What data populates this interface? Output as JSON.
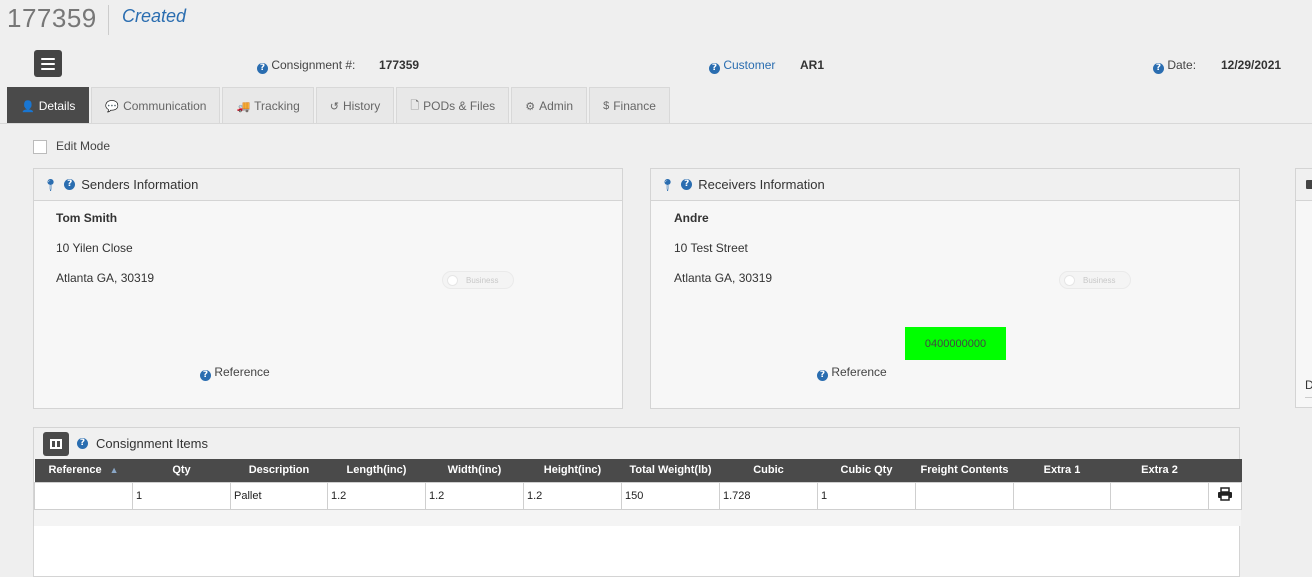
{
  "header": {
    "consignment_number": "177359",
    "status": "Created",
    "consignment_label": "Consignment #:",
    "consignment_value": "177359",
    "customer_label": "Customer",
    "customer_value": "AR1",
    "date_label": "Date:",
    "date_value": "12/29/2021"
  },
  "tabs": [
    {
      "label": "Details",
      "icon": "user-icon",
      "glyph": "👤"
    },
    {
      "label": "Communication",
      "icon": "comment-icon",
      "glyph": "💬"
    },
    {
      "label": "Tracking",
      "icon": "truck-icon",
      "glyph": "🚚"
    },
    {
      "label": "History",
      "icon": "history-icon",
      "glyph": "↺"
    },
    {
      "label": "PODs & Files",
      "icon": "file-icon",
      "glyph": "🗋"
    },
    {
      "label": "Admin",
      "icon": "gear-icon",
      "glyph": "⚙"
    },
    {
      "label": "Finance",
      "icon": "dollar-icon",
      "glyph": "$"
    }
  ],
  "edit_mode": {
    "label": "Edit Mode",
    "checked": false
  },
  "senders": {
    "title": "Senders Information",
    "name": "Tom Smith",
    "address1": "10 Yilen Close",
    "address2": "Atlanta GA, 30319",
    "business_label": "Business",
    "reference_label": "Reference"
  },
  "receivers": {
    "title": "Receivers Information",
    "name": "Andre",
    "address1": "10 Test Street",
    "address2": "Atlanta GA, 30319",
    "business_label": "Business",
    "phone": "0400000000",
    "reference_label": "Reference"
  },
  "items": {
    "title": "Consignment Items",
    "columns": [
      "Reference",
      "Qty",
      "Description",
      "Length(inc)",
      "Width(inc)",
      "Height(inc)",
      "Total Weight(lb)",
      "Cubic",
      "Cubic Qty",
      "Freight Contents",
      "Extra 1",
      "Extra 2"
    ],
    "rows": [
      {
        "reference": "",
        "qty": "1",
        "description": "Pallet",
        "length": "1.2",
        "width": "1.2",
        "height": "1.2",
        "weight": "150",
        "cubic": "1.728",
        "cubic_qty": "1",
        "freight": "",
        "extra1": "",
        "extra2": ""
      }
    ]
  },
  "right_panel": {
    "partial_letter": "D"
  },
  "colors": {
    "accent": "#2a6db0",
    "dark": "#4a4a4a",
    "phone_bg": "#00ff00"
  }
}
